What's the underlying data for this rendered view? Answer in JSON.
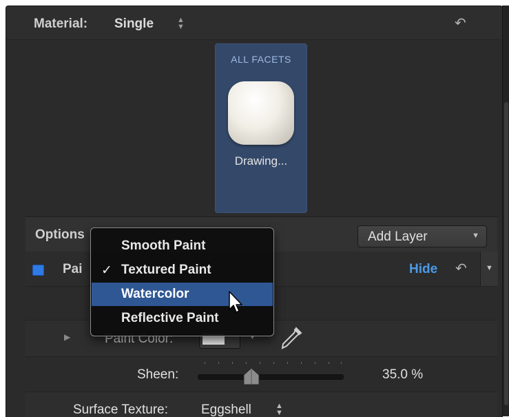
{
  "material": {
    "label": "Material:",
    "value": "Single"
  },
  "facet": {
    "title": "ALL FACETS",
    "name": "Drawing..."
  },
  "options": {
    "label": "Options",
    "add_layer": "Add Layer"
  },
  "paint_row": {
    "label": "Pai",
    "hide": "Hide"
  },
  "paint_color": {
    "label": "Paint Color:"
  },
  "sheen": {
    "label": "Sheen:",
    "value": "35.0 %"
  },
  "surface_texture": {
    "label": "Surface Texture:",
    "value": "Eggshell"
  },
  "menu": {
    "items": [
      {
        "label": "Smooth Paint",
        "check": ""
      },
      {
        "label": "Textured Paint",
        "check": "✓"
      },
      {
        "label": "Watercolor",
        "check": ""
      },
      {
        "label": "Reflective Paint",
        "check": ""
      }
    ]
  },
  "icons": {
    "reset": "undo-arrow-icon",
    "updown": "up-down-arrows-icon",
    "dropper": "eyedropper-icon",
    "cursor": "mouse-pointer-icon"
  },
  "colors": {
    "panel": "#2b2b2b",
    "facet_bg": "#34496a",
    "highlight": "#2f5794",
    "link": "#4b9be8",
    "checkbox": "#2e7ae6"
  }
}
